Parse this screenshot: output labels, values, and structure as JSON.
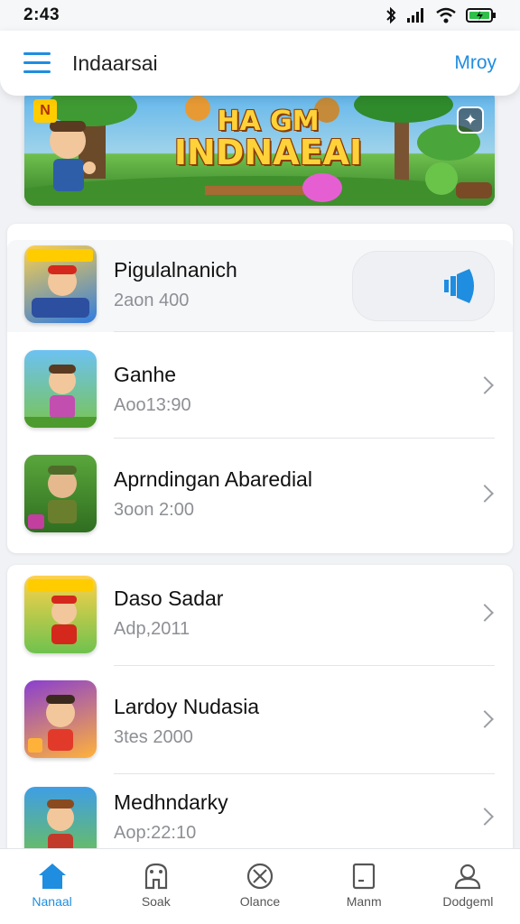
{
  "status_bar": {
    "time": "2:43",
    "icons": [
      "bluetooth-icon",
      "signal-icon",
      "wifi-icon",
      "battery-icon"
    ]
  },
  "header": {
    "title": "Indaarsai",
    "action_label": "Mroy"
  },
  "banner": {
    "line1": "HA GM",
    "line2": "INDNAEAI",
    "badge": "N"
  },
  "section1": {
    "items": [
      {
        "title": "Pigulalnanich",
        "subtitle": "2aon 400",
        "accent": "#1f8de0"
      },
      {
        "title": "Ganhe",
        "subtitle": "Aoo13:90"
      },
      {
        "title": "Aprndingan Abaredial",
        "subtitle": "3oon 2:00"
      }
    ]
  },
  "section2": {
    "items": [
      {
        "title": "Daso Sadar",
        "subtitle": "Adp,2011"
      },
      {
        "title": "Lardoy Nudasia",
        "subtitle": "3tes 2000"
      },
      {
        "title": "Medhndarky",
        "subtitle": "Aop:22:10"
      }
    ]
  },
  "bottom_nav": {
    "items": [
      {
        "label": "Nanaal",
        "icon": "home-icon"
      },
      {
        "label": "Soak",
        "icon": "store-icon"
      },
      {
        "label": "Olance",
        "icon": "cancel-circle-icon"
      },
      {
        "label": "Manm",
        "icon": "document-icon"
      },
      {
        "label": "Dodgeml",
        "icon": "profile-icon"
      }
    ]
  },
  "colors": {
    "accent": "#1f8de0",
    "background": "#f1f2f5"
  }
}
